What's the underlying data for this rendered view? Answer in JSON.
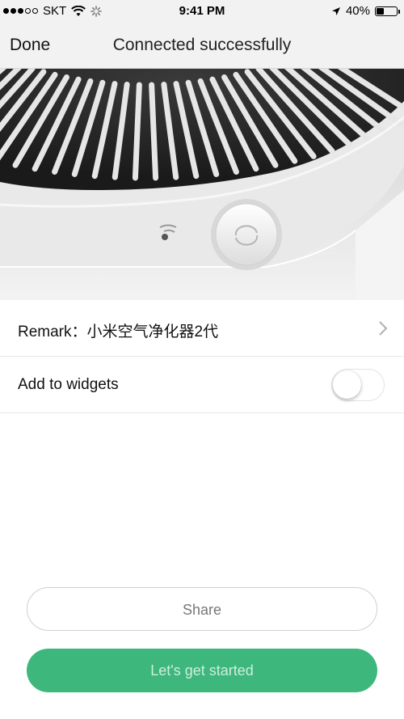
{
  "status_bar": {
    "carrier": "SKT",
    "time": "9:41 PM",
    "battery_percent": "40%",
    "battery_level": 0.4,
    "signal_bars_filled": 3,
    "signal_bars_total": 5
  },
  "nav": {
    "done_label": "Done",
    "title": "Connected successfully"
  },
  "settings": {
    "remark_label": "Remark：小米空气净化器2代",
    "widgets_label": "Add to widgets",
    "widgets_enabled": false
  },
  "actions": {
    "share_label": "Share",
    "start_label": "Let's get started"
  },
  "colors": {
    "accent": "#3db77b",
    "bar_background": "#f2f2f2"
  }
}
